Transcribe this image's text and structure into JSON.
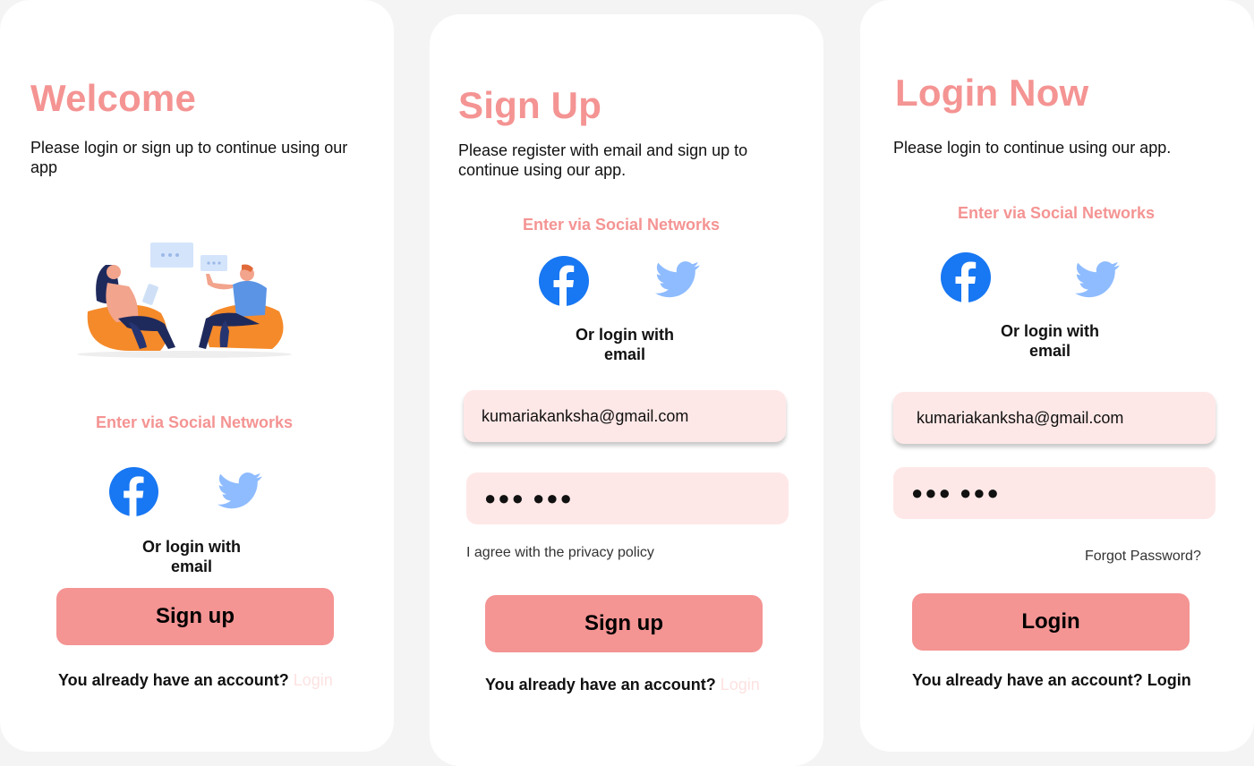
{
  "welcome": {
    "title": "Welcome",
    "subtitle": "Please login or sign up to continue using our app",
    "social_title": "Enter via Social Networks",
    "or_login": "Or login with email",
    "button": "Sign up",
    "footer_text": "You already have an account?",
    "footer_link": "Login"
  },
  "signup": {
    "title": "Sign Up",
    "subtitle": "Please register with email and sign up to continue using our app.",
    "social_title": "Enter via Social Networks",
    "or_login": "Or login with email",
    "email_value": "kumariakanksha@gmail.com",
    "password_value": "●●● ●●●",
    "privacy_text": "I agree with the privacy policy",
    "button": "Sign up",
    "footer_text": "You already have an account?",
    "footer_link": "Login"
  },
  "login": {
    "title": "Login Now",
    "subtitle": "Please login to continue using our app.",
    "social_title": "Enter via Social Networks",
    "or_login": "Or login with email",
    "email_value": "kumariakanksha@gmail.com",
    "password_value": "●●● ●●●",
    "forgot": "Forgot Password?",
    "button": "Login",
    "footer_text": "You already have an account?",
    "footer_link": "Login"
  },
  "colors": {
    "accent": "#f49493",
    "field_bg": "#fee8e7",
    "facebook": "#1877f2",
    "twitter": "#8fbcff"
  },
  "icons": [
    "facebook-icon",
    "twitter-icon",
    "illustration-people-chatting"
  ]
}
